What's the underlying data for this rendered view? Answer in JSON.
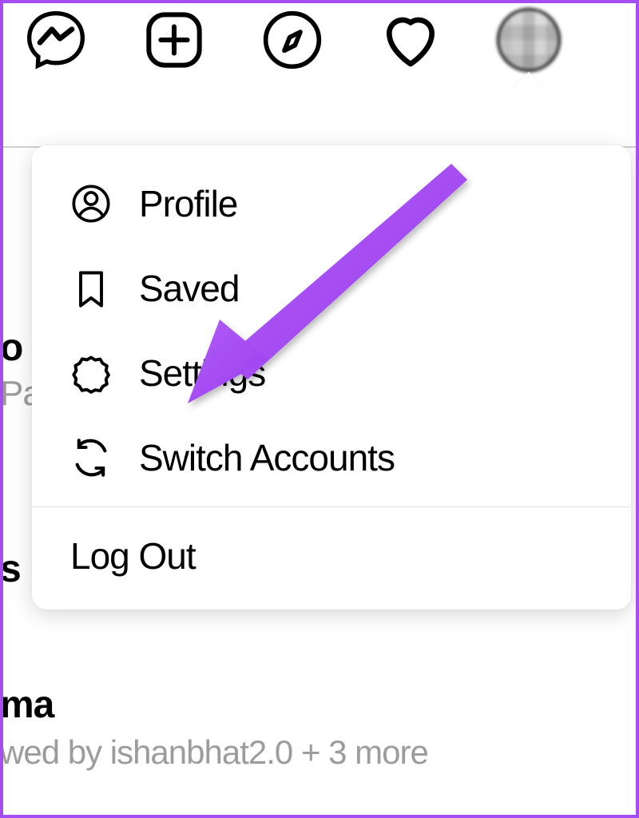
{
  "annotation": {
    "highlight_color": "#a44df2"
  },
  "topbar": {
    "icons": [
      {
        "name": "messenger-icon"
      },
      {
        "name": "create-icon"
      },
      {
        "name": "explore-icon"
      },
      {
        "name": "activity-heart-icon"
      },
      {
        "name": "avatar"
      }
    ]
  },
  "menu": {
    "items": [
      {
        "id": "profile",
        "label": "Profile",
        "icon": "profile-icon"
      },
      {
        "id": "saved",
        "label": "Saved",
        "icon": "saved-icon"
      },
      {
        "id": "settings",
        "label": "Settings",
        "icon": "settings-icon"
      },
      {
        "id": "switch",
        "label": "Switch Accounts",
        "icon": "switch-accounts-icon"
      }
    ],
    "logout_label": "Log Out"
  },
  "background": {
    "fragments": {
      "line1_suffix": "o",
      "line2_prefix": "Pa",
      "line3_prefix": "s ",
      "line4_prefix": "ma",
      "followed_text": "wed by ishanbhat2.0 + 3 more"
    }
  }
}
